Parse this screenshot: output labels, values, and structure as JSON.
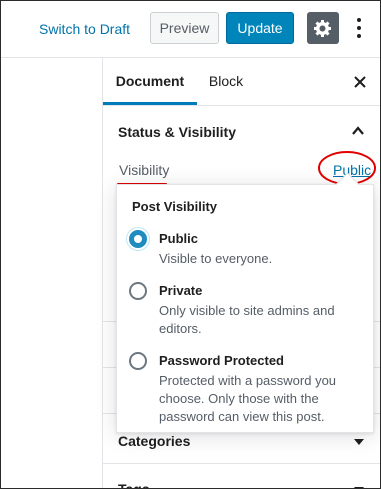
{
  "toolbar": {
    "switch_to_draft": "Switch to Draft",
    "preview": "Preview",
    "update": "Update",
    "settings_icon": "gear-icon",
    "more_icon": "more-vertical-icon"
  },
  "sidebar": {
    "tabs": [
      {
        "label": "Document",
        "active": true
      },
      {
        "label": "Block",
        "active": false
      }
    ],
    "close_icon": "close-icon",
    "status_visibility": {
      "title": "Status & Visibility",
      "expanded": true,
      "visibility_label": "Visibility",
      "visibility_value": "Public"
    },
    "categories_label": "Categories",
    "tags_label": "Tags"
  },
  "popover": {
    "title": "Post Visibility",
    "options": [
      {
        "label": "Public",
        "description": "Visible to everyone.",
        "checked": true
      },
      {
        "label": "Private",
        "description": "Only visible to site admins and editors.",
        "checked": false
      },
      {
        "label": "Password Protected",
        "description": "Protected with a password you choose. Only those with the password can view this post.",
        "checked": false
      }
    ]
  },
  "colors": {
    "accent": "#0085ba",
    "link": "#0073aa",
    "annotation": "#e10000"
  }
}
